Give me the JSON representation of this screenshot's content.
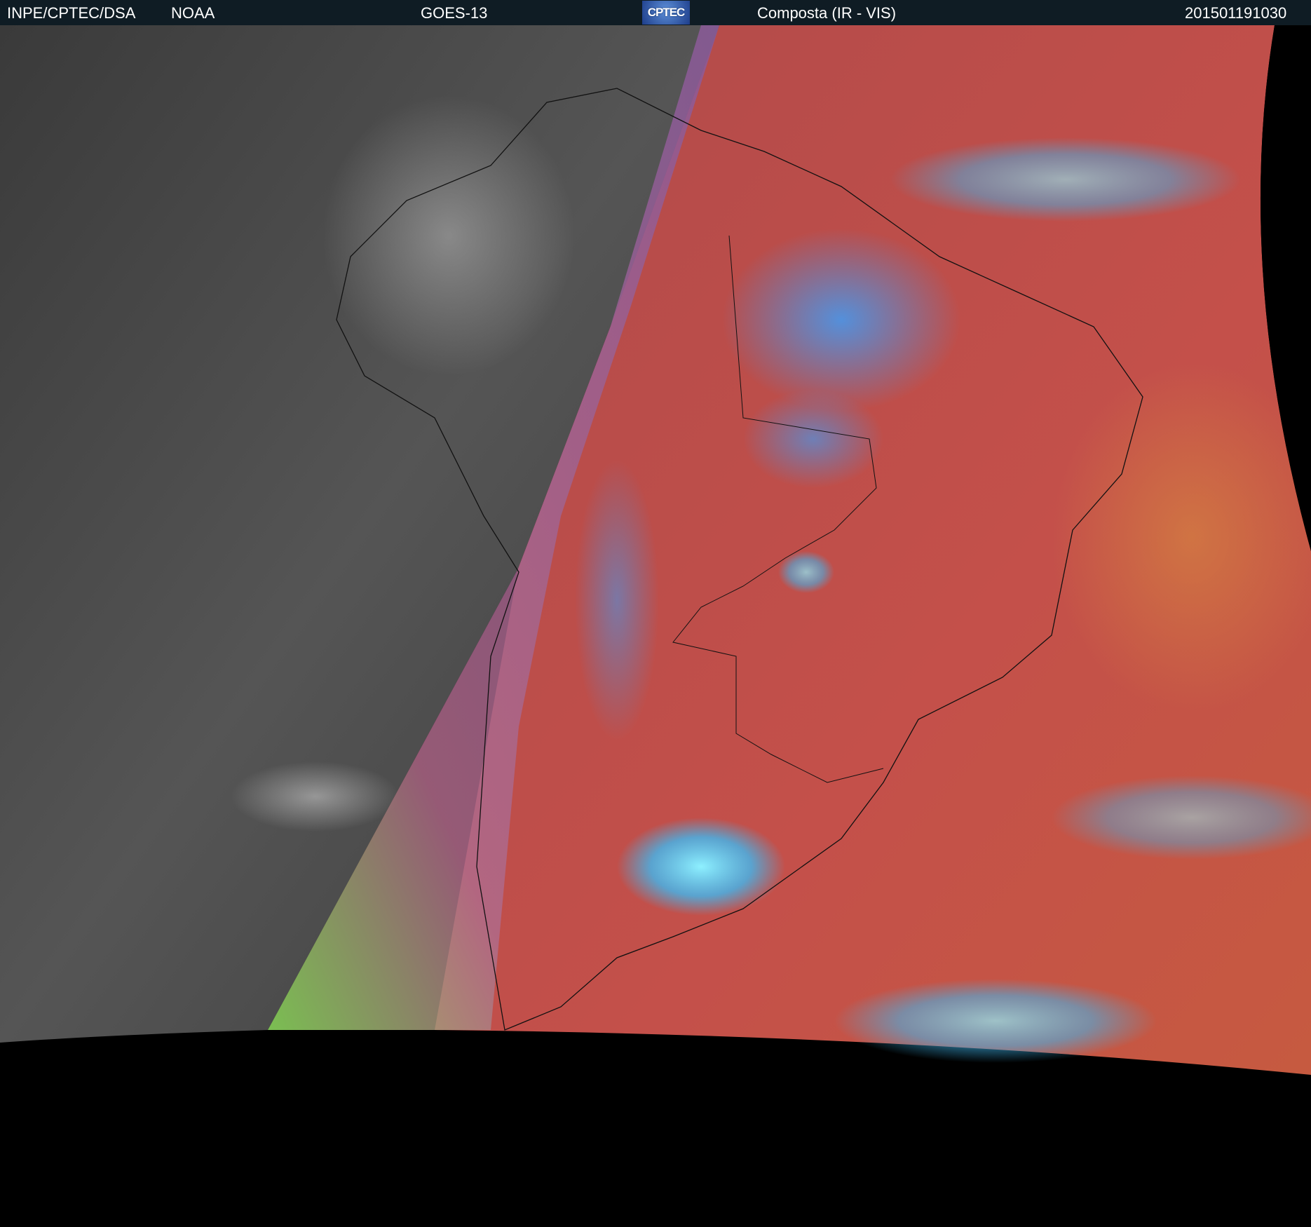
{
  "header": {
    "agency": "INPE/CPTEC/DSA",
    "partner": "NOAA",
    "satellite": "GOES-13",
    "logo_text": "CPTEC",
    "product": "Composta (IR - VIS)",
    "timestamp": "201501191030"
  },
  "colors": {
    "header_bg": "#0f1c24",
    "night_gray": "#4a4a4a",
    "day_red": "#b84848",
    "cloud_cyan": "#40c8f0",
    "terminator_green": "#90e060"
  }
}
